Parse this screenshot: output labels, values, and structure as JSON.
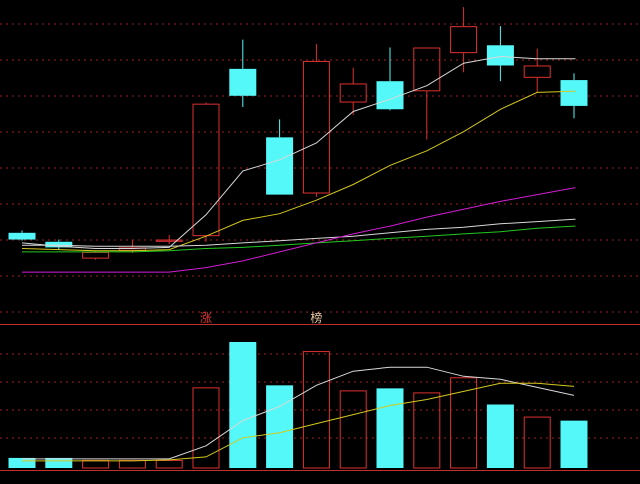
{
  "chart_data": {
    "type": "candlestick",
    "title": "",
    "xlabel": "",
    "ylabel": "",
    "grid": true,
    "candles": [
      {
        "open": 2.0,
        "close": 2.6,
        "high": 2.8,
        "low": 1.9,
        "direction": "down"
      },
      {
        "open": 1.3,
        "close": 1.8,
        "high": 2.0,
        "low": 1.1,
        "direction": "down"
      },
      {
        "open": 0.3,
        "close": 0.9,
        "high": 1.0,
        "low": 0.2,
        "direction": "up"
      },
      {
        "open": 1.0,
        "close": 1.3,
        "high": 2.0,
        "low": 0.8,
        "direction": "up"
      },
      {
        "open": 1.8,
        "close": 2.0,
        "high": 2.4,
        "low": 1.6,
        "direction": "up"
      },
      {
        "open": 2.3,
        "close": 14.1,
        "high": 14.2,
        "low": 1.8,
        "direction": "up"
      },
      {
        "open": 14.8,
        "close": 17.2,
        "high": 19.8,
        "low": 13.8,
        "direction": "down"
      },
      {
        "open": 6.0,
        "close": 11.1,
        "high": 12.7,
        "low": 6.0,
        "direction": "down"
      },
      {
        "open": 6.1,
        "close": 17.9,
        "high": 19.4,
        "low": 5.8,
        "direction": "up"
      },
      {
        "open": 14.2,
        "close": 15.9,
        "high": 17.3,
        "low": 13.1,
        "direction": "up"
      },
      {
        "open": 13.6,
        "close": 16.1,
        "high": 19.1,
        "low": 13.5,
        "direction": "down"
      },
      {
        "open": 15.2,
        "close": 19.1,
        "high": 19.1,
        "low": 10.9,
        "direction": "up"
      },
      {
        "open": 18.6,
        "close": 21.0,
        "high": 22.7,
        "low": 16.9,
        "direction": "up"
      },
      {
        "open": 17.5,
        "close": 19.3,
        "high": 21.0,
        "low": 16.1,
        "direction": "down"
      },
      {
        "open": 16.4,
        "close": 17.5,
        "high": 19.0,
        "low": 15.1,
        "direction": "up"
      },
      {
        "open": 13.9,
        "close": 16.2,
        "high": 16.8,
        "low": 12.8,
        "direction": "down"
      }
    ],
    "ma_lines": [
      {
        "color": "#d8d8d8",
        "values": [
          1.7,
          1.4,
          1.2,
          1.2,
          1.3,
          4.2,
          8.1,
          9.1,
          10.6,
          13.4,
          14.5,
          15.7,
          17.7,
          18.3,
          18.1,
          18.1
        ]
      },
      {
        "color": "#d4c81e",
        "values": [
          1.2,
          1.1,
          1.0,
          1.0,
          1.1,
          2.3,
          3.7,
          4.3,
          5.5,
          6.9,
          8.6,
          9.9,
          11.6,
          13.6,
          15.1,
          15.2
        ]
      },
      {
        "color": "#d8d8d8",
        "values": [
          1.5,
          1.5,
          1.4,
          1.4,
          1.4,
          1.5,
          1.7,
          1.9,
          2.1,
          2.3,
          2.6,
          2.9,
          3.1,
          3.4,
          3.6,
          3.8
        ]
      },
      {
        "color": "#22c81e",
        "values": [
          0.9,
          0.9,
          0.9,
          0.9,
          1.0,
          1.2,
          1.3,
          1.5,
          1.7,
          1.9,
          2.1,
          2.3,
          2.5,
          2.7,
          3.0,
          3.2
        ]
      },
      {
        "color": "#d21ed2",
        "values": [
          -0.9,
          -0.9,
          -0.9,
          -0.9,
          -0.9,
          -0.5,
          0.1,
          0.9,
          1.7,
          2.5,
          3.2,
          4.0,
          4.7,
          5.4,
          6.0,
          6.6
        ]
      }
    ],
    "volume": {
      "values": [
        1.0,
        1.0,
        0.8,
        0.8,
        0.8,
        8.0,
        12.5,
        8.2,
        11.6,
        7.7,
        7.9,
        7.5,
        9.0,
        6.3,
        5.1,
        4.7
      ],
      "ma_lines": [
        {
          "color": "#d8d8d8",
          "values": [
            0.9,
            0.9,
            0.9,
            0.9,
            0.9,
            2.2,
            4.7,
            6.1,
            8.2,
            9.6,
            10.0,
            10.0,
            9.1,
            8.8,
            8.0,
            7.2
          ]
        },
        {
          "color": "#d4c81e",
          "values": [
            0.7,
            0.7,
            0.7,
            0.7,
            0.8,
            1.1,
            3.0,
            3.5,
            4.4,
            5.3,
            6.2,
            6.8,
            7.6,
            8.4,
            8.4,
            8.1
          ]
        }
      ]
    },
    "annotations": [
      {
        "text": "涨",
        "index": 5,
        "color": "#e03030"
      },
      {
        "text": "榜",
        "index": 8,
        "color": "#e8c8a0"
      }
    ],
    "colors": {
      "up": "#e03030",
      "down": "#54f8f8",
      "grid": "#a02020",
      "divider": "#c03030",
      "background": "#000000"
    }
  }
}
